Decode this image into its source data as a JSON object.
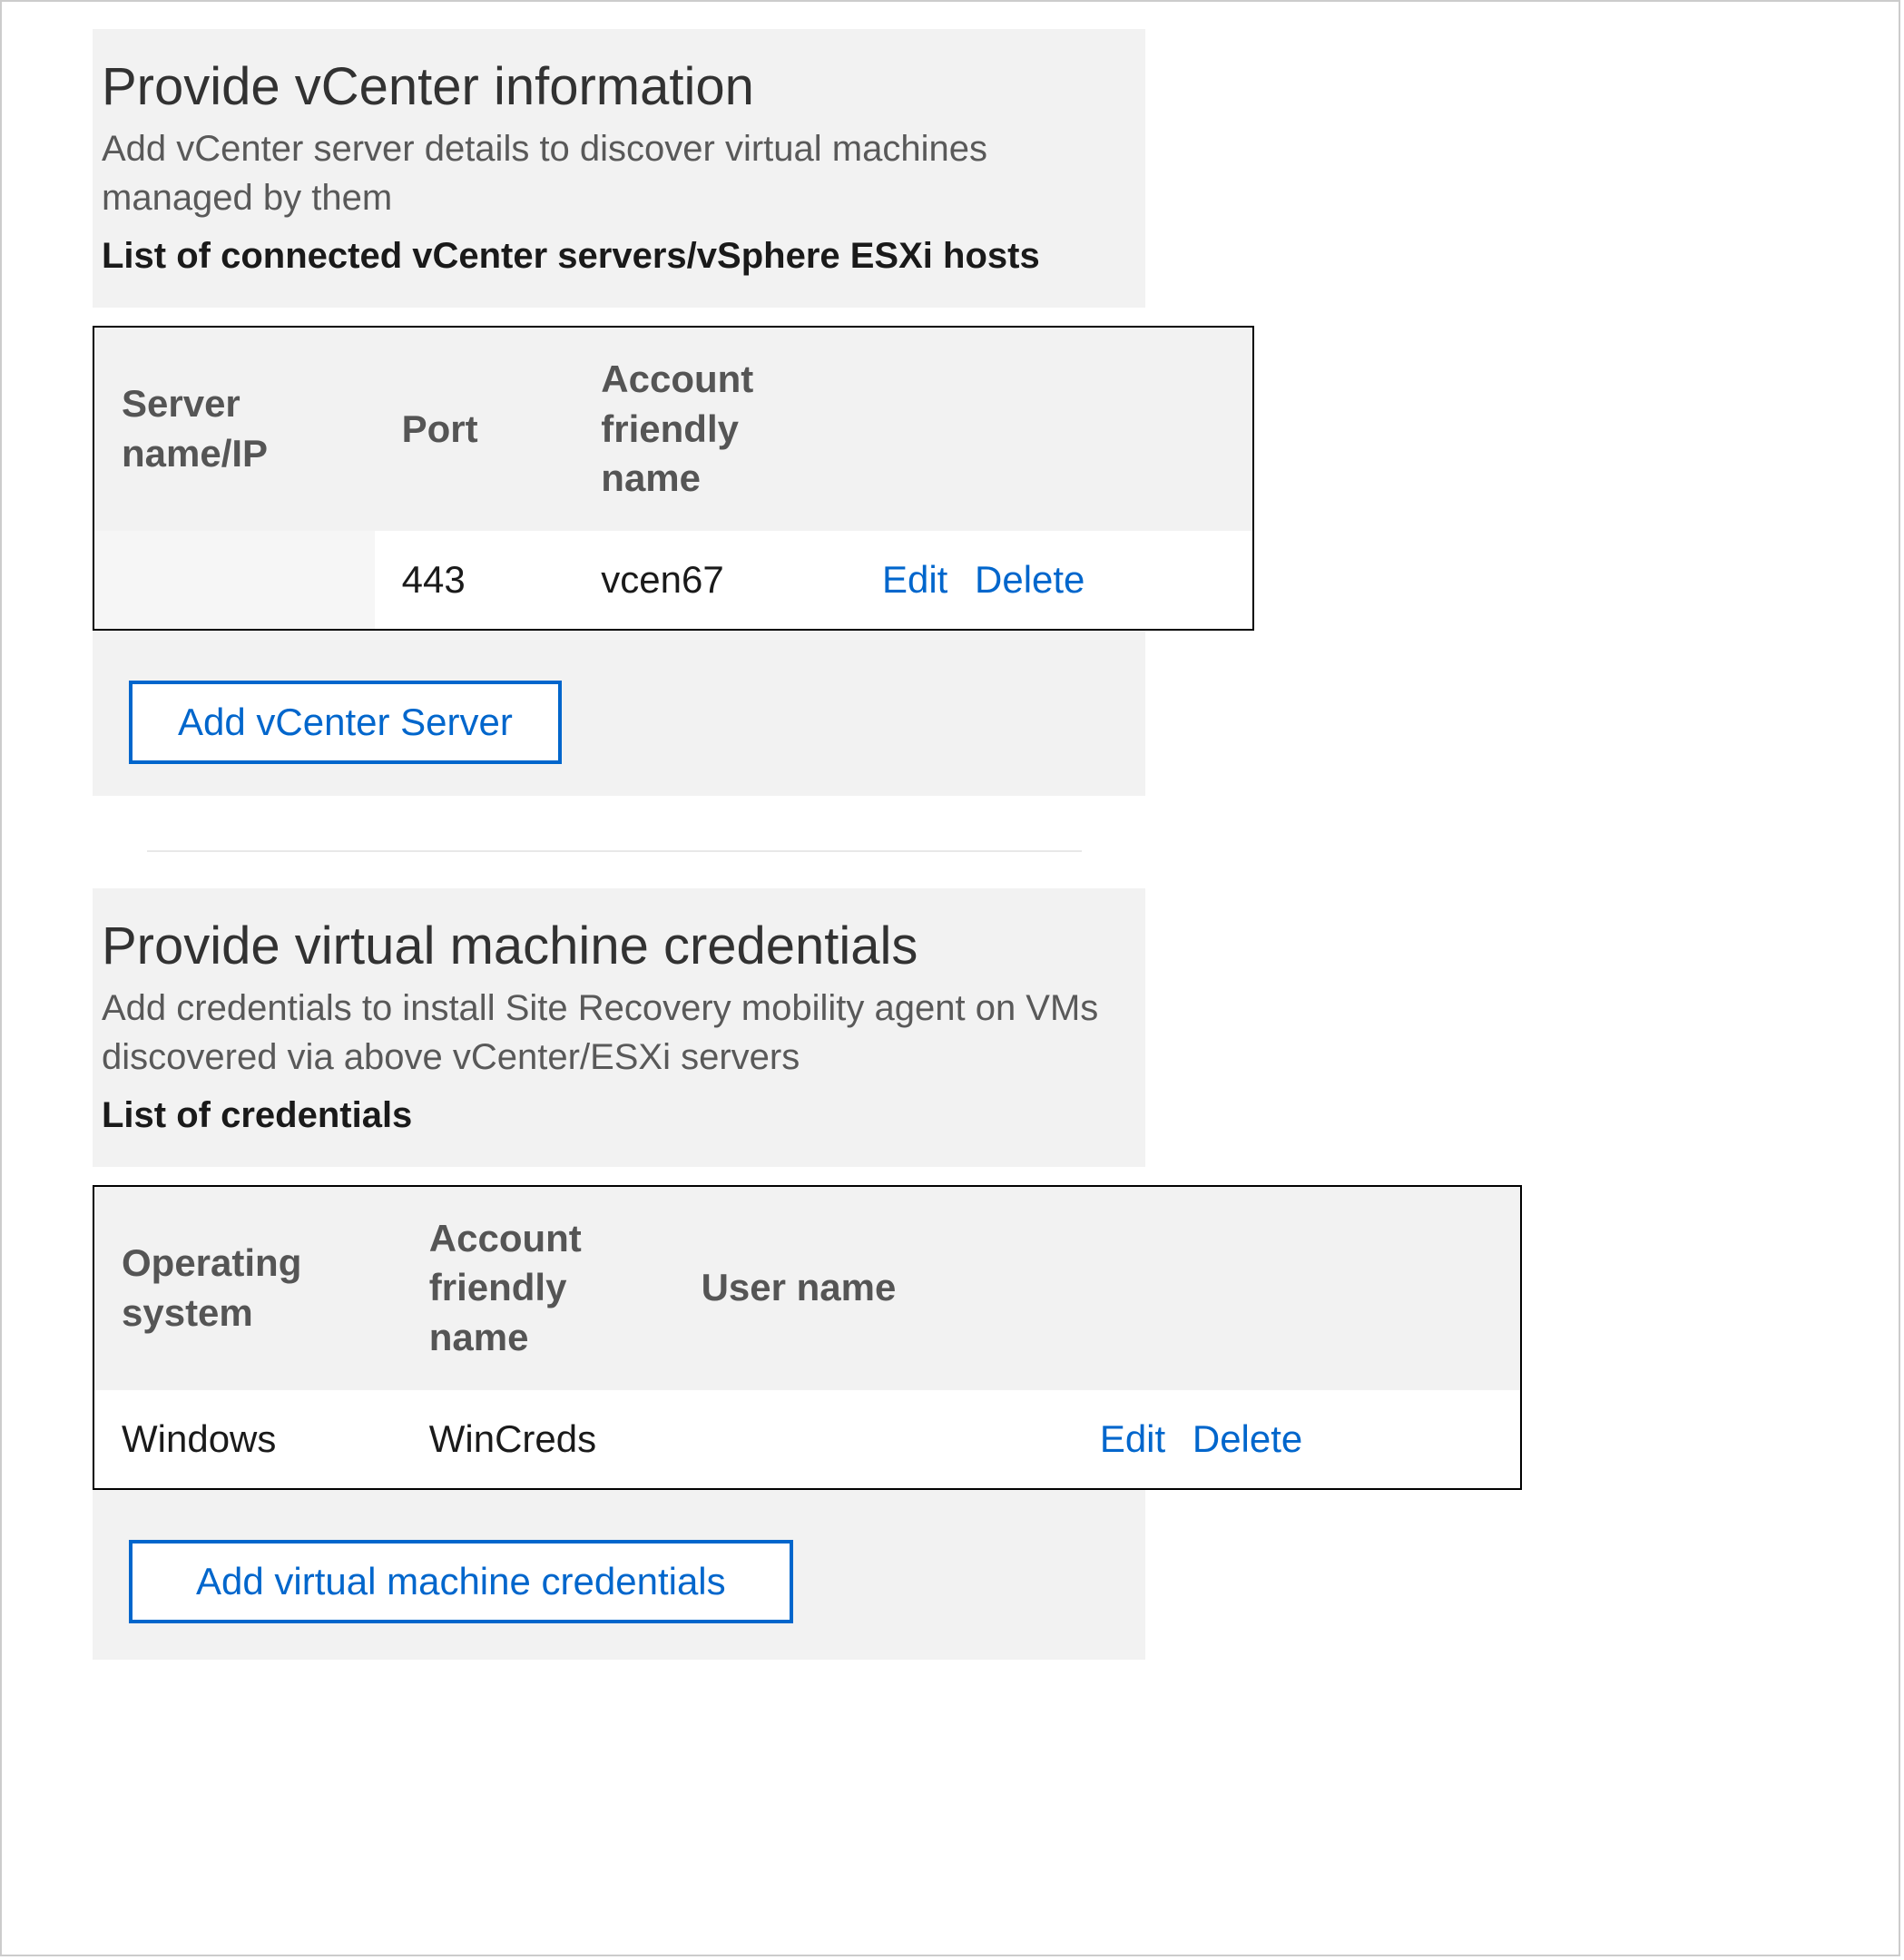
{
  "vcenter_section": {
    "title": "Provide vCenter information",
    "description": "Add vCenter server details to discover virtual machines managed by them",
    "list_label": "List of connected vCenter servers/vSphere ESXi hosts",
    "headers": {
      "server": "Server name/IP",
      "port": "Port",
      "account": "Account friendly name"
    },
    "row": {
      "server": "",
      "port": "443",
      "account": "vcen67",
      "edit": "Edit",
      "delete": "Delete"
    },
    "add_button": "Add vCenter Server"
  },
  "vm_creds_section": {
    "title": "Provide virtual machine credentials",
    "description": "Add credentials to install Site Recovery mobility agent on VMs discovered via above vCenter/ESXi servers",
    "list_label": "List of credentials",
    "headers": {
      "os": "Operating system",
      "account": "Account friendly name",
      "username": "User name"
    },
    "row": {
      "os": "Windows",
      "account": "WinCreds",
      "username": "",
      "edit": "Edit",
      "delete": "Delete"
    },
    "add_button": "Add virtual machine credentials"
  }
}
